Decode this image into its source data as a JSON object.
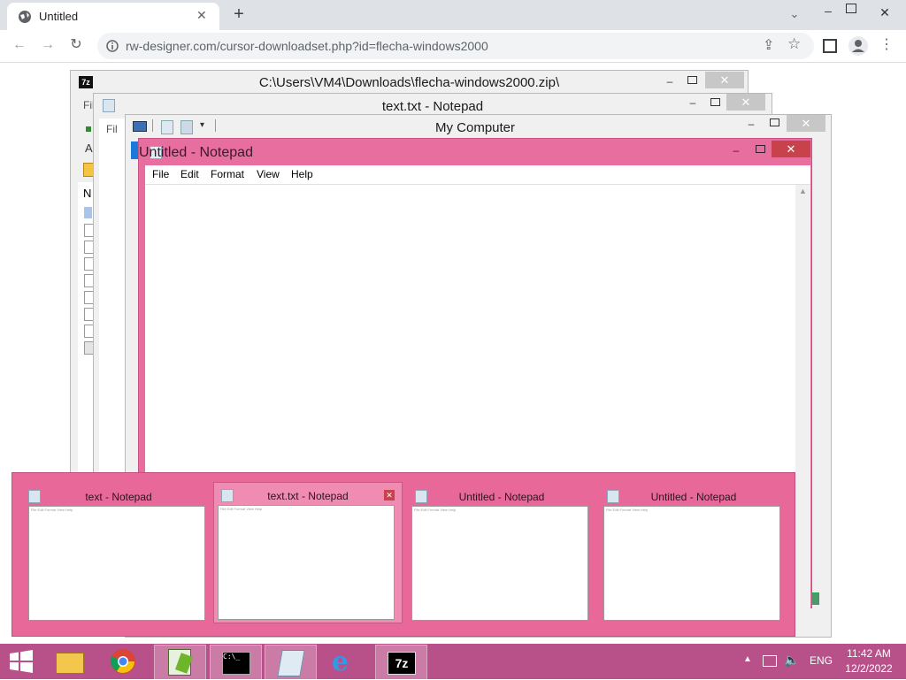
{
  "browser": {
    "tab_title": "Untitled",
    "url": "rw-designer.com/cursor-downloadset.php?id=flecha-windows2000"
  },
  "windows": {
    "zip": {
      "title": "C:\\Users\\VM4\\Downloads\\flecha-windows2000.zip\\",
      "menu_fragment": "Fil",
      "col_fragment": "N",
      "row_fragment": "A"
    },
    "textnotepad": {
      "title": "text.txt - Notepad",
      "menu_fragment": "Fil"
    },
    "mycomputer": {
      "title": "My Computer"
    },
    "notepad": {
      "title": "Untitled - Notepad",
      "menu": [
        "File",
        "Edit",
        "Format",
        "View",
        "Help"
      ]
    }
  },
  "switcher": {
    "items": [
      {
        "title": "text - Notepad"
      },
      {
        "title": "text.txt - Notepad"
      },
      {
        "title": "Untitled - Notepad"
      },
      {
        "title": "Untitled - Notepad"
      }
    ],
    "preview_menu": "File  Edit  Format  View  Help"
  },
  "taskbar": {
    "apps": [
      "Windows Explorer",
      "Google Chrome",
      "Notepad++",
      "Command Prompt",
      "Notepad",
      "Internet Explorer",
      "7-Zip"
    ],
    "language": "ENG",
    "time": "11:42 AM",
    "date": "12/2/2022",
    "seven_zip_label": "7z"
  },
  "colors": {
    "accent_pink": "#e96ea0",
    "taskbar": "#b8508a",
    "close_red": "#c7424b"
  }
}
